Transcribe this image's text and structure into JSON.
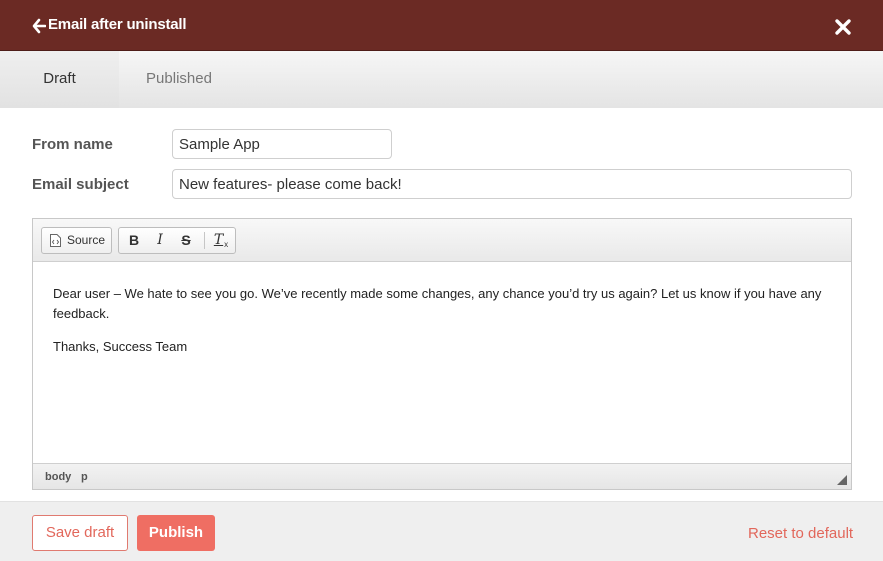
{
  "modal": {
    "title": "Email after uninstall",
    "back_icon": "arrow-left-icon",
    "close_icon": "close-icon"
  },
  "tabs": [
    {
      "label": "Draft",
      "active": true
    },
    {
      "label": "Published",
      "active": false
    }
  ],
  "form": {
    "from_name_label": "From name",
    "from_name_value": "Sample App",
    "subject_label": "Email subject",
    "subject_value": "New features- please come back!"
  },
  "editor": {
    "toolbar": {
      "source_label": "Source",
      "source_icon": "source-icon",
      "bold_label": "B",
      "italic_label": "I",
      "strike_label": "S",
      "remove_format_label": "T",
      "remove_format_sub": "x"
    },
    "body": {
      "paragraphs": [
        "Dear user – We hate to see you go. We’ve recently made some changes, any chance you’d try us again? Let us know if you have any feedback.",
        "Thanks, Success Team"
      ]
    },
    "status_path": [
      "body",
      "p"
    ]
  },
  "footer": {
    "save_draft_label": "Save draft",
    "publish_label": "Publish",
    "reset_label": "Reset to default"
  },
  "colors": {
    "titlebar": "#6b2a24",
    "accent": "#ef6e63"
  }
}
